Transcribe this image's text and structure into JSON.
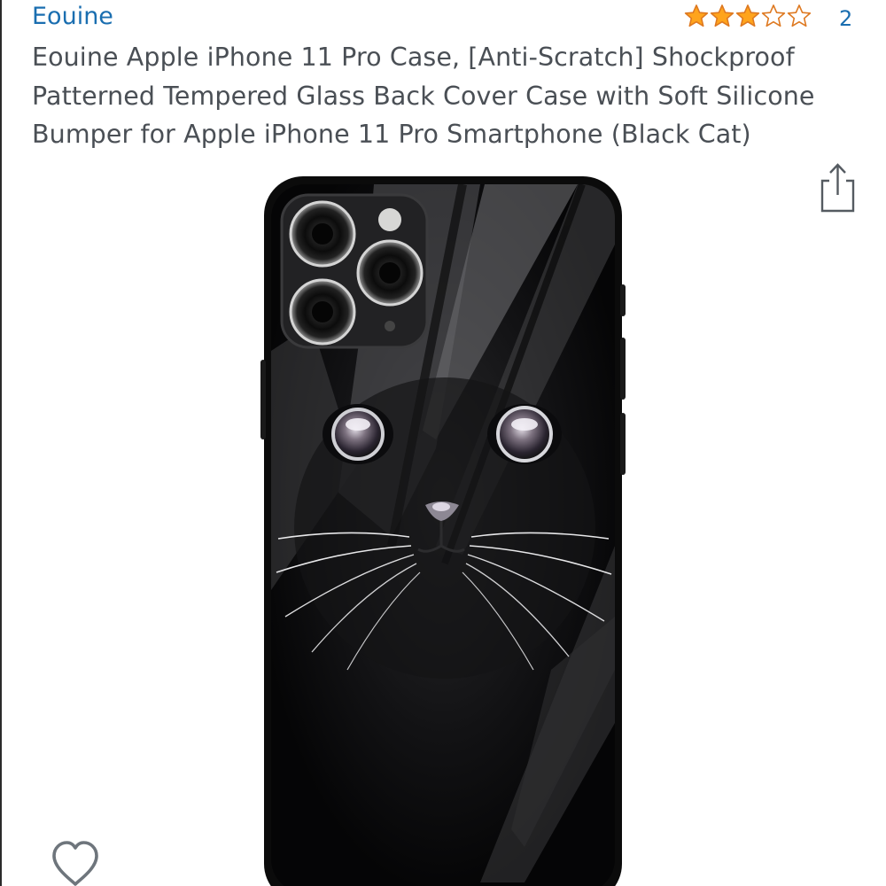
{
  "product": {
    "brand": "Eouine",
    "title": "Eouine Apple iPhone 11 Pro Case, [Anti-Scratch] Shockproof Patterned Tempered Glass Back Cover Case with Soft Silicone Bumper for Apple iPhone 11 Pro Smartphone (Black Cat)",
    "rating": {
      "stars": 3,
      "out_of": 5,
      "count": "2"
    }
  },
  "icons": {
    "share": "share-icon",
    "wishlist": "heart-outline-icon",
    "star_filled": "star-filled-icon",
    "star_empty": "star-empty-icon"
  },
  "colors": {
    "link": "#1a6eb0",
    "star_fill": "#ffa41c",
    "star_stroke": "#de7921",
    "title_text": "#4a4f55"
  }
}
